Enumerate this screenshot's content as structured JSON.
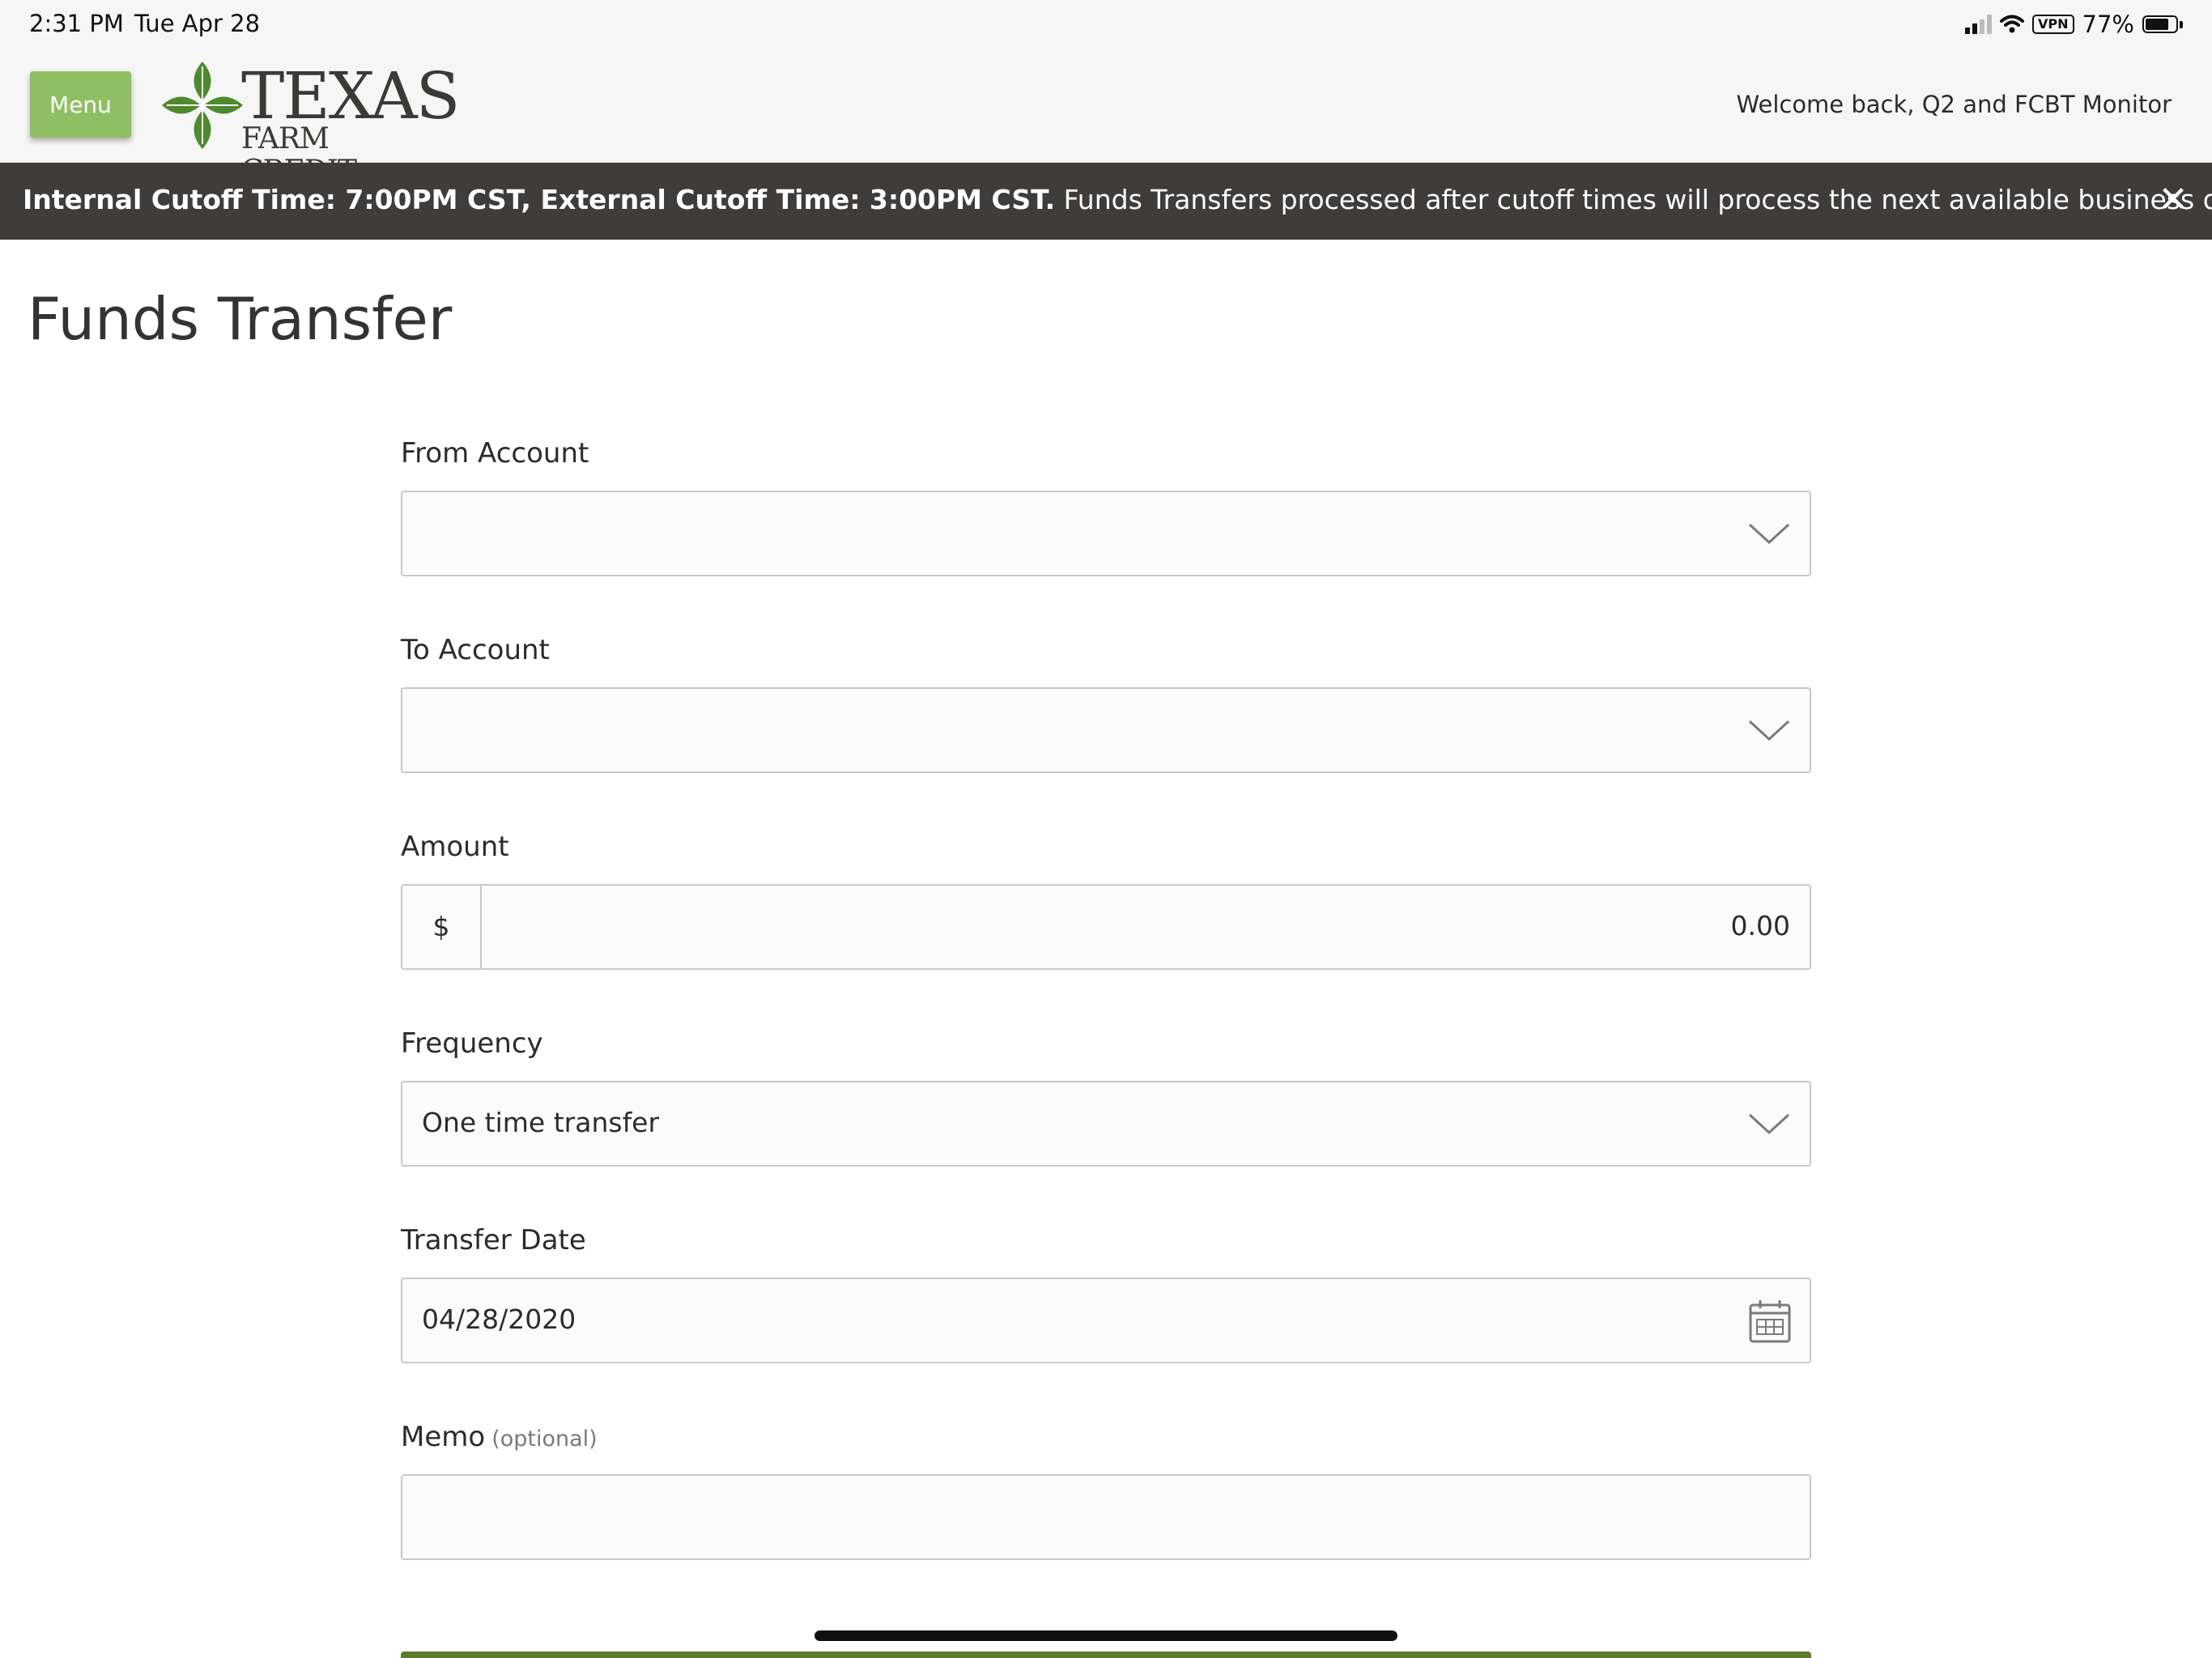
{
  "status_bar": {
    "time": "2:31 PM",
    "date": "Tue Apr 28",
    "vpn": "VPN",
    "battery": "77%",
    "battery_level": 0.77
  },
  "header": {
    "menu_label": "Menu",
    "logo_line1": "TEXAS",
    "logo_line2": "FARM CREDIT",
    "welcome": "Welcome back, Q2 and FCBT Monitor"
  },
  "banner": {
    "bold_text": "Internal Cutoff Time: 7:00PM CST, External Cutoff Time: 3:00PM CST.",
    "text": " Funds Transfers processed after cutoff times will process the next available business day.",
    "close_glyph": "✕"
  },
  "page": {
    "title": "Funds Transfer"
  },
  "form": {
    "from_account": {
      "label": "From Account",
      "value": ""
    },
    "to_account": {
      "label": "To Account",
      "value": ""
    },
    "amount": {
      "label": "Amount",
      "prefix": "$",
      "value": "0.00"
    },
    "frequency": {
      "label": "Frequency",
      "value": "One time transfer"
    },
    "transfer_date": {
      "label": "Transfer Date",
      "value": "04/28/2020"
    },
    "memo": {
      "label": "Memo",
      "optional": "(optional)",
      "value": ""
    }
  },
  "colors": {
    "brand_green": "#90bf63",
    "logo_green": "#4e8a2e",
    "banner_bg": "#3f3d3c",
    "submit_green": "#5d7d2c"
  }
}
